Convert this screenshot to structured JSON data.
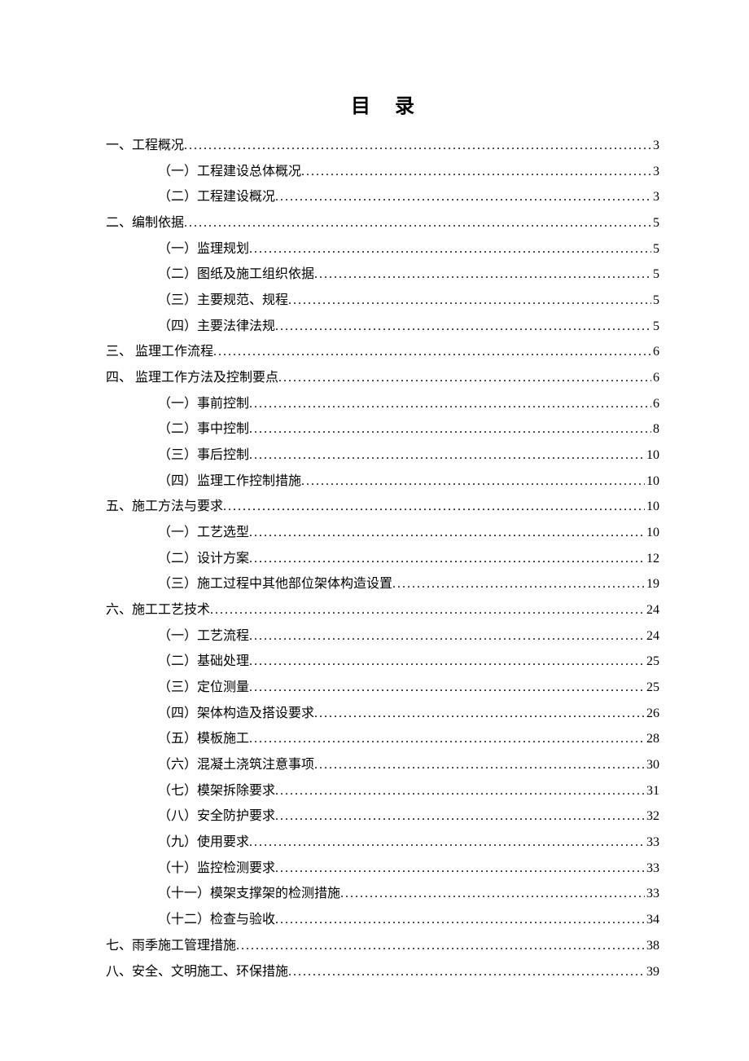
{
  "title": "目录",
  "toc": [
    {
      "level": 1,
      "label": "一、工程概况",
      "page": "3"
    },
    {
      "level": 2,
      "label": "（一）工程建设总体概况",
      "page": "3"
    },
    {
      "level": 2,
      "label": "（二）工程建设概况",
      "page": "3"
    },
    {
      "level": 1,
      "label": "二、编制依据",
      "page": "5"
    },
    {
      "level": 2,
      "label": "（一）监理规划",
      "page": "5"
    },
    {
      "level": 2,
      "label": "（二）图纸及施工组织依据",
      "page": "5"
    },
    {
      "level": 2,
      "label": "（三）主要规范、规程",
      "page": "5"
    },
    {
      "level": 2,
      "label": "（四）主要法律法规",
      "page": "5"
    },
    {
      "level": 1,
      "label": "三、 监理工作流程",
      "page": "6"
    },
    {
      "level": 1,
      "label": "四、 监理工作方法及控制要点",
      "page": "6"
    },
    {
      "level": 2,
      "label": "（一）事前控制",
      "page": "6"
    },
    {
      "level": 2,
      "label": "（二）事中控制",
      "page": "8"
    },
    {
      "level": 2,
      "label": "（三）事后控制",
      "page": "10"
    },
    {
      "level": 2,
      "label": "（四）监理工作控制措施",
      "page": "10"
    },
    {
      "level": 1,
      "label": "五、施工方法与要求",
      "page": "10"
    },
    {
      "level": 2,
      "label": "（一）工艺选型",
      "page": "10"
    },
    {
      "level": 2,
      "label": "（二）设计方案",
      "page": "12"
    },
    {
      "level": 2,
      "label": "（三）施工过程中其他部位架体构造设置",
      "page": "19"
    },
    {
      "level": 1,
      "label": "六、施工工艺技术",
      "page": "24"
    },
    {
      "level": 2,
      "label": "（一）工艺流程",
      "page": "24"
    },
    {
      "level": 2,
      "label": "（二）基础处理",
      "page": "25"
    },
    {
      "level": 2,
      "label": "（三）定位测量",
      "page": "25"
    },
    {
      "level": 2,
      "label": "（四）架体构造及搭设要求",
      "page": "26"
    },
    {
      "level": 2,
      "label": "（五）模板施工",
      "page": "28"
    },
    {
      "level": 2,
      "label": "（六）混凝土浇筑注意事项",
      "page": "30"
    },
    {
      "level": 2,
      "label": "（七）模架拆除要求",
      "page": "31"
    },
    {
      "level": 2,
      "label": "（八）安全防护要求",
      "page": "32"
    },
    {
      "level": 2,
      "label": "（九）使用要求",
      "page": "33"
    },
    {
      "level": 2,
      "label": "（十）监控检测要求",
      "page": "33"
    },
    {
      "level": 2,
      "label": "（十一）模架支撑架的检测措施",
      "page": "33"
    },
    {
      "level": 2,
      "label": "（十二）检查与验收",
      "page": "34"
    },
    {
      "level": 1,
      "label": "七、雨季施工管理措施",
      "page": "38"
    },
    {
      "level": 1,
      "label": "八、安全、文明施工、环保措施",
      "page": "39"
    }
  ]
}
